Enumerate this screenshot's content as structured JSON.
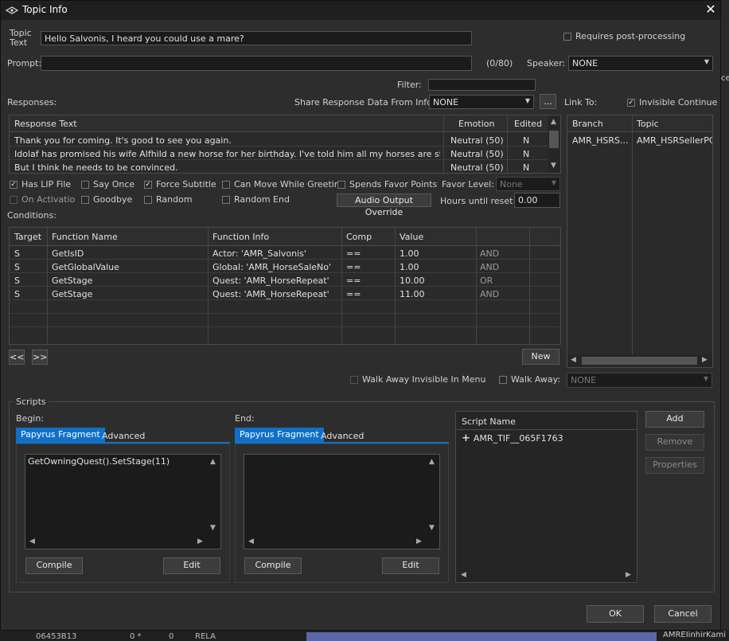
{
  "window": {
    "title": "Topic Info"
  },
  "topic": {
    "label_line1": "Topic",
    "label_line2": "Text",
    "text": "Hello Salvonis, I heard you could use a mare?"
  },
  "requires_post": {
    "label": "Requires post-processing",
    "checked": false
  },
  "prompt": {
    "label": "Prompt:",
    "value": "",
    "counter": "(0/80)"
  },
  "speaker": {
    "label": "Speaker:",
    "value": "NONE"
  },
  "filter": {
    "label": "Filter:",
    "value": ""
  },
  "responses": {
    "label": "Responses:",
    "share_label": "Share Response Data From Info:",
    "share_value": "NONE",
    "share_button": "...",
    "columns": [
      "Response Text",
      "Emotion",
      "Edited"
    ],
    "rows": [
      {
        "text": "Thank you for coming. It's good to see you again.",
        "emotion": "Neutral (50)",
        "edited": "N"
      },
      {
        "text": "Idolaf has promised his wife Alfhild a new horse for her birthday. I've told him all my horses are strong and ...",
        "emotion": "Neutral (50)",
        "edited": "N"
      },
      {
        "text": "But I think he needs to be convinced.",
        "emotion": "Neutral (50)",
        "edited": "N"
      }
    ]
  },
  "link_to": {
    "label": "Link To:",
    "invisible_continue": "Invisible Continue",
    "columns": [
      "Branch",
      "Topic"
    ],
    "rows": [
      {
        "branch": "AMR_HSRS...",
        "topic": "AMR_HSRSellerPC"
      }
    ]
  },
  "flags": {
    "has_lip": "Has LIP File",
    "say_once": "Say Once",
    "force_subtitle": "Force Subtitle",
    "can_move": "Can Move While Greeting",
    "spends_favor": "Spends Favor Points",
    "favor_level_label": "Favor Level:",
    "favor_level_value": "None",
    "on_activation": "On Activation",
    "goodbye": "Goodbye",
    "random": "Random",
    "random_end": "Random End",
    "audio_override": "Audio Output Override",
    "hours_label": "Hours until reset:",
    "hours_value": "0.00"
  },
  "conditions": {
    "label": "Conditions:",
    "columns": [
      "Target",
      "Function Name",
      "Function Info",
      "Comp",
      "Value"
    ],
    "rows": [
      {
        "target": "S",
        "func": "GetIsID",
        "info": "Actor: 'AMR_Salvonis'",
        "comp": "==",
        "value": "1.00",
        "op": "AND"
      },
      {
        "target": "S",
        "func": "GetGlobalValue",
        "info": "Global: 'AMR_HorseSaleNo'",
        "comp": "==",
        "value": "1.00",
        "op": "AND"
      },
      {
        "target": "S",
        "func": "GetStage",
        "info": "Quest: 'AMR_HorseRepeat'",
        "comp": "==",
        "value": "10.00",
        "op": "OR"
      },
      {
        "target": "S",
        "func": "GetStage",
        "info": "Quest: 'AMR_HorseRepeat'",
        "comp": "==",
        "value": "11.00",
        "op": "AND"
      }
    ],
    "prev_button": "<<",
    "next_button": ">>",
    "new_button": "New"
  },
  "walk_away_invisible": "Walk Away Invisible In Menu",
  "walk_away": {
    "label": "Walk Away:",
    "value": "NONE"
  },
  "scripts": {
    "label": "Scripts",
    "begin_label": "Begin:",
    "end_label": "End:",
    "tab_fragment": "Papyrus Fragment",
    "tab_advanced": "Advanced",
    "begin_code": "GetOwningQuest().SetStage(11)",
    "end_code": "",
    "compile": "Compile",
    "edit": "Edit",
    "script_name_header": "Script Name",
    "script_items": [
      "AMR_TIF__065F1763"
    ],
    "add": "Add",
    "remove": "Remove",
    "properties": "Properties"
  },
  "footer": {
    "ok": "OK",
    "cancel": "Cancel"
  },
  "background": {
    "row_id": "06453B13",
    "row_v1": "0 *",
    "row_v2": "0",
    "row_type": "RELA",
    "right_text": "AMREIinhirKami",
    "right_edge": "ce"
  }
}
